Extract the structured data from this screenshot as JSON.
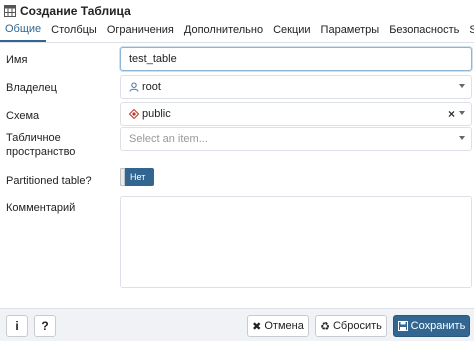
{
  "window": {
    "title": "Создание Таблица",
    "icon": "table-icon"
  },
  "tabs": [
    {
      "label": "Общие",
      "active": true
    },
    {
      "label": "Столбцы",
      "active": false
    },
    {
      "label": "Ограничения",
      "active": false
    },
    {
      "label": "Дополнительно",
      "active": false
    },
    {
      "label": "Секции",
      "active": false
    },
    {
      "label": "Параметры",
      "active": false
    },
    {
      "label": "Безопасность",
      "active": false
    },
    {
      "label": "SQL",
      "active": false
    }
  ],
  "form": {
    "name": {
      "label": "Имя",
      "value": "test_table"
    },
    "owner": {
      "label": "Владелец",
      "value": "root",
      "icon": "user-icon"
    },
    "schema": {
      "label": "Схема",
      "value": "public",
      "icon": "schema-icon",
      "clear": "×"
    },
    "tablespace": {
      "label": "Табличное пространство",
      "label_line1": "Табличное",
      "label_line2": "пространство",
      "placeholder": "Select an item..."
    },
    "partitioned": {
      "label": "Partitioned table?",
      "value": "Нет"
    },
    "comment": {
      "label": "Комментарий",
      "value": ""
    }
  },
  "footer": {
    "info_icon": "i",
    "help_icon": "?",
    "cancel_label": "Отмена",
    "reset_label": "Сбросить",
    "save_label": "Сохранить"
  },
  "colors": {
    "accent": "#326690",
    "border": "#dde0e6",
    "footer_bg": "#f0f2f5"
  }
}
